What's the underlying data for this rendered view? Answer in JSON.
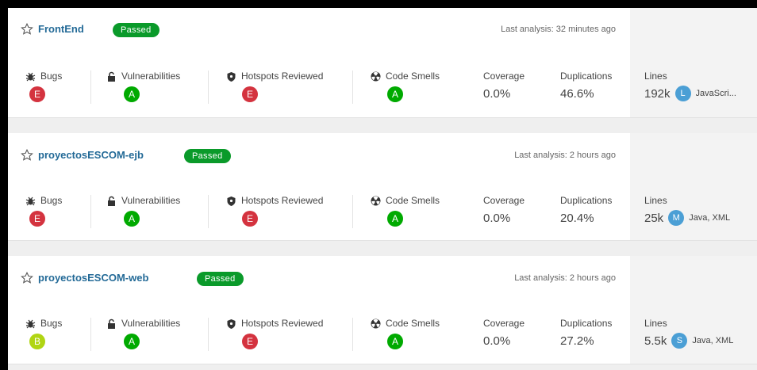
{
  "labels": {
    "bugs": "Bugs",
    "vulnerabilities": "Vulnerabilities",
    "hotspots": "Hotspots Reviewed",
    "code_smells": "Code Smells",
    "coverage": "Coverage",
    "duplications": "Duplications",
    "lines": "Lines"
  },
  "colors": {
    "rating_E": "#d4333f",
    "rating_A": "#00aa00",
    "rating_B": "#b0d513",
    "passed": "#0a9a2a",
    "project_link": "#236a97"
  },
  "projects": [
    {
      "name": "FrontEnd",
      "status": "Passed",
      "last_analysis": "Last analysis: 32 minutes ago",
      "bugs": "E",
      "vulnerabilities": "A",
      "hotspots": "E",
      "code_smells": "A",
      "coverage": "0.0%",
      "duplications": "46.6%",
      "lines": "192k",
      "lang_initial": "L",
      "languages": "JavaScri..."
    },
    {
      "name": "proyectosESCOM-ejb",
      "status": "Passed",
      "last_analysis": "Last analysis: 2 hours ago",
      "bugs": "E",
      "vulnerabilities": "A",
      "hotspots": "E",
      "code_smells": "A",
      "coverage": "0.0%",
      "duplications": "20.4%",
      "lines": "25k",
      "lang_initial": "M",
      "languages": "Java, XML"
    },
    {
      "name": "proyectosESCOM-web",
      "status": "Passed",
      "last_analysis": "Last analysis: 2 hours ago",
      "bugs": "B",
      "vulnerabilities": "A",
      "hotspots": "E",
      "code_smells": "A",
      "coverage": "0.0%",
      "duplications": "27.2%",
      "lines": "5.5k",
      "lang_initial": "S",
      "languages": "Java, XML"
    }
  ]
}
